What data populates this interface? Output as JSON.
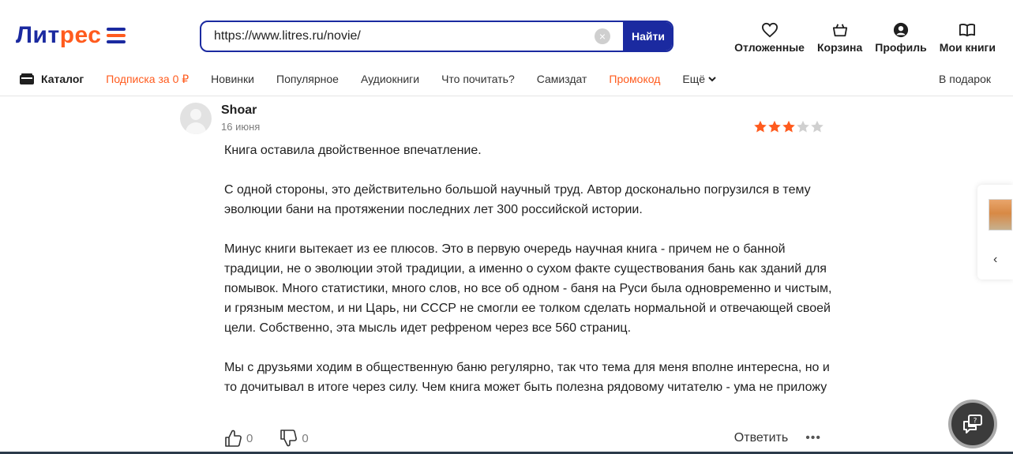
{
  "header": {
    "logo": {
      "part1": "Лит",
      "part2": "рес"
    },
    "search": {
      "value": "https://www.litres.ru/novie/",
      "clear_icon": "clear-icon",
      "button_label": "Найти"
    },
    "user_nav": [
      {
        "label": "Отложенные",
        "icon": "heart-icon"
      },
      {
        "label": "Корзина",
        "icon": "basket-icon"
      },
      {
        "label": "Профиль",
        "icon": "profile-icon"
      },
      {
        "label": "Мои книги",
        "icon": "book-icon"
      }
    ]
  },
  "menu": {
    "items": [
      {
        "label": "Каталог",
        "style": "bold"
      },
      {
        "label": "Подписка за 0 ₽",
        "style": "orange"
      },
      {
        "label": "Новинки"
      },
      {
        "label": "Популярное"
      },
      {
        "label": "Аудиокниги"
      },
      {
        "label": "Что почитать?"
      },
      {
        "label": "Самиздат"
      },
      {
        "label": "Промокод",
        "style": "orange"
      },
      {
        "label": "Ещё"
      }
    ],
    "right": "В подарок"
  },
  "review": {
    "author": "Shoar",
    "date": "16 июня",
    "rating": 3,
    "max_rating": 5,
    "paragraphs": [
      "Книга оставила двойственное впечатление.",
      "С одной стороны, это действительно большой научный труд. Автор досконально погрузился в тему эволюции бани на протяжении последних лет 300 российской истории.",
      "Минус книги вытекает из ее плюсов. Это в первую очередь научная книга - причем не о банной традиции, не о эволюции этой традиции, а именно о сухом факте существования бань как зданий для помывок. Много статистики, много слов, но все об одном - баня на Руси была одновременно и чистым, и грязным местом, и ни Царь, ни СССР не смогли ее толком сделать нормальной и отвечающей своей цели. Собственно, эта мысль идет рефреном через все 560 страниц.",
      "Мы с друзьями ходим в общественную баню регулярно, так что тема для меня вполне интересна, но и то дочитывал в итоге через силу. Чем книга может быть полезна рядовому читателю - ума не приложу"
    ],
    "likes": "0",
    "dislikes": "0",
    "reply_label": "Ответить",
    "more_label": "•••"
  },
  "colors": {
    "brand_blue": "#1b2aa0",
    "brand_orange": "#ff5b1e",
    "star_active": "#ff5b1e",
    "star_inactive": "#d0d0d0"
  }
}
